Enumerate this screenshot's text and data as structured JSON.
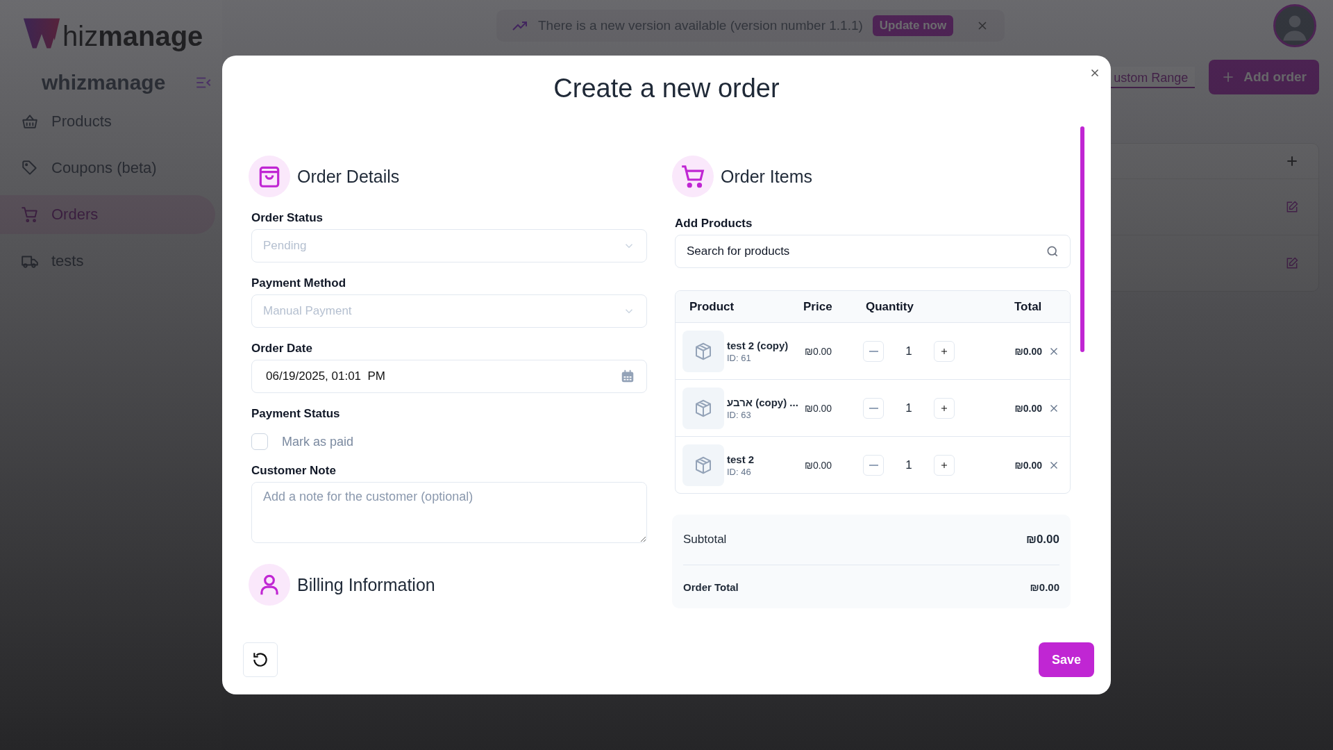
{
  "sidebar": {
    "logo": "hiz**manage**",
    "brand": "whizmanage",
    "items": [
      {
        "label": "Products",
        "selected": false
      },
      {
        "label": "Coupons (beta)",
        "selected": false
      },
      {
        "label": "Orders",
        "selected": true
      },
      {
        "label": "tests",
        "selected": false
      }
    ]
  },
  "banner": {
    "message": "There is a new version available (version number 1.1.1)",
    "action": "Update now"
  },
  "toolbar": {
    "range": "ustom Range",
    "add": "Add order"
  },
  "modal": {
    "title": "Create a new order",
    "order_details": {
      "title": "Order Details",
      "fields": [
        {
          "kind": "select",
          "label": "Order Status",
          "value": "Pending"
        },
        {
          "kind": "select",
          "label": "Payment Method",
          "value": "Manual Payment"
        },
        {
          "kind": "datetime",
          "label": "Order Date",
          "value": "06/19/2025, 01:01  PM"
        },
        {
          "kind": "checkbox",
          "label": "Payment Status",
          "option": "Mark as paid",
          "checked": false
        },
        {
          "kind": "textarea",
          "label": "Customer Note",
          "placeholder": "Add a note for the customer (optional)"
        }
      ]
    },
    "billing": {
      "title": "Billing Information"
    },
    "order_items": {
      "title": "Order Items",
      "search_label": "Add Products",
      "search_placeholder": "Search for products",
      "columns": [
        "Product",
        "Price",
        "Quantity",
        "Total"
      ],
      "rows": [
        {
          "name": "test 2 (copy)",
          "id": "ID: 61",
          "price": "₪0.00",
          "quantity": "1",
          "total": "₪0.00"
        },
        {
          "name": "ארבע (copy) ...",
          "id": "ID: 63",
          "price": "₪0.00",
          "quantity": "1",
          "total": "₪0.00"
        },
        {
          "name": "test 2",
          "id": "ID: 46",
          "price": "₪0.00",
          "quantity": "1",
          "total": "₪0.00"
        }
      ],
      "subtotal_label": "Subtotal",
      "subtotal": "₪0.00",
      "total_label": "Order Total",
      "total": "₪0.00"
    },
    "save": "Save"
  }
}
